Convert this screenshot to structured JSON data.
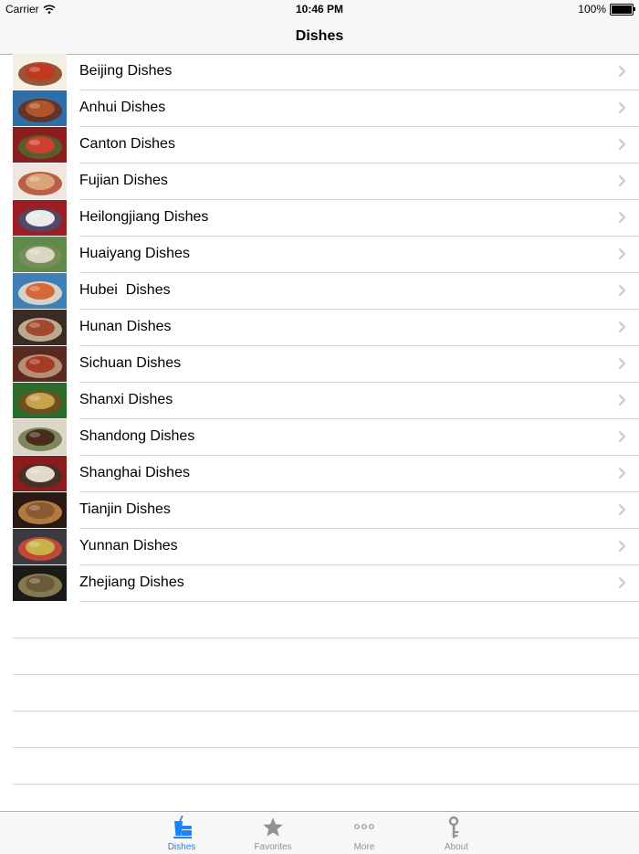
{
  "status_bar": {
    "carrier": "Carrier",
    "time": "10:46 PM",
    "battery": "100%"
  },
  "nav": {
    "title": "Dishes"
  },
  "dishes": [
    {
      "label": "Beijing Dishes",
      "colors": [
        "#f4efe3",
        "#c0391d",
        "#8a3a1a"
      ]
    },
    {
      "label": "Anhui Dishes",
      "colors": [
        "#2f6fa8",
        "#b0552a",
        "#6b2c15"
      ]
    },
    {
      "label": "Canton Dishes",
      "colors": [
        "#8a1d1d",
        "#d04030",
        "#4c6a2c"
      ]
    },
    {
      "label": "Fujian Dishes",
      "colors": [
        "#efe7df",
        "#d8a47a",
        "#b0452e"
      ]
    },
    {
      "label": "Heilongjiang Dishes",
      "colors": [
        "#9a1e24",
        "#e8ece8",
        "#4b4e6e"
      ]
    },
    {
      "label": "Huaiyang Dishes",
      "colors": [
        "#5e8a4a",
        "#d9d7c4",
        "#7a8d5c"
      ]
    },
    {
      "label": "Hubei  Dishes",
      "colors": [
        "#3e7fb5",
        "#d8673a",
        "#f2e0cc"
      ]
    },
    {
      "label": "Hunan Dishes",
      "colors": [
        "#3a2b25",
        "#a34a2e",
        "#d2c0a6"
      ]
    },
    {
      "label": "Sichuan Dishes",
      "colors": [
        "#5a2a20",
        "#a63a24",
        "#c59d85"
      ]
    },
    {
      "label": "Shanxi Dishes",
      "colors": [
        "#2c6b2c",
        "#c9a24e",
        "#7a4a1f"
      ]
    },
    {
      "label": "Shandong Dishes",
      "colors": [
        "#dcd6c8",
        "#4a2c1c",
        "#6a7a4a"
      ]
    },
    {
      "label": "Shanghai Dishes",
      "colors": [
        "#8c1c1c",
        "#e2d8cc",
        "#3a3228"
      ]
    },
    {
      "label": "Tianjin Dishes",
      "colors": [
        "#2a1a12",
        "#8a5a30",
        "#c98c4a"
      ]
    },
    {
      "label": "Yunnan Dishes",
      "colors": [
        "#3a3a40",
        "#c9b14a",
        "#d84a3a"
      ]
    },
    {
      "label": "Zhejiang Dishes",
      "colors": [
        "#1a1a18",
        "#6a5a3a",
        "#9a8a5a"
      ]
    }
  ],
  "tabs": [
    {
      "label": "Dishes",
      "icon": "dishes-icon",
      "active": true
    },
    {
      "label": "Favorites",
      "icon": "star-icon",
      "active": false
    },
    {
      "label": "More",
      "icon": "more-icon",
      "active": false
    },
    {
      "label": "About",
      "icon": "key-icon",
      "active": false
    }
  ],
  "colors": {
    "active_tab": "#1a82fb",
    "inactive_tab": "#929292",
    "separator": "#d6d6d6",
    "bar_bg": "#f7f7f7"
  }
}
